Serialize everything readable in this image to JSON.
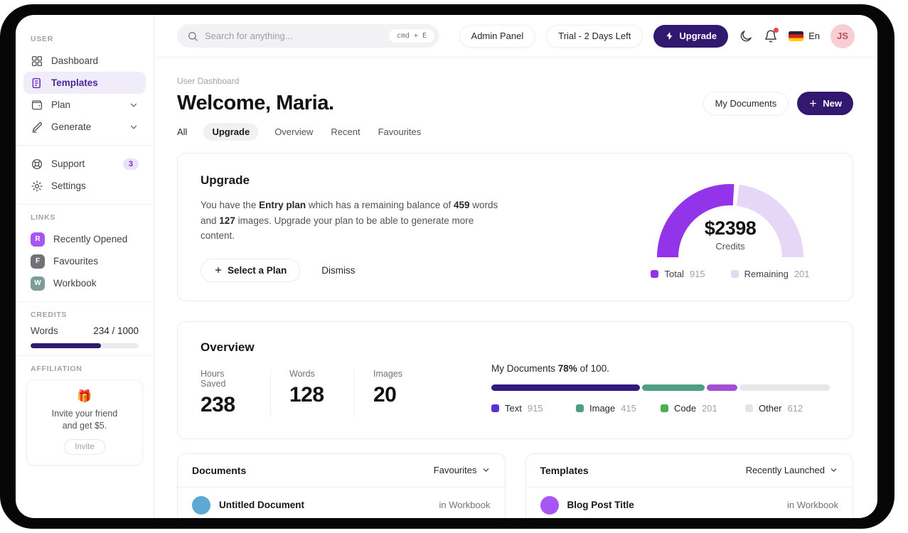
{
  "topbar": {
    "search_placeholder": "Search for anything...",
    "search_shortcut": "cmd + E",
    "admin_panel": "Admin Panel",
    "trial": "Trial - 2 Days Left",
    "upgrade": "Upgrade",
    "language": "En",
    "avatar_initials": "JS"
  },
  "sidebar": {
    "user_label": "USER",
    "nav": [
      {
        "label": "Dashboard"
      },
      {
        "label": "Templates"
      },
      {
        "label": "Plan"
      },
      {
        "label": "Generate"
      }
    ],
    "support": {
      "label": "Support",
      "badge": "3"
    },
    "settings": {
      "label": "Settings"
    },
    "links_label": "LINKS",
    "links": [
      {
        "initial": "R",
        "label": "Recently Opened",
        "color": "#a855f7"
      },
      {
        "initial": "F",
        "label": "Favourites",
        "color": "#71717a"
      },
      {
        "initial": "W",
        "label": "Workbook",
        "color": "#7d9e97"
      }
    ],
    "credits": {
      "label": "CREDITS",
      "metric": "Words",
      "value": "234 / 1000",
      "fill_pct": "65%",
      "fill_color": "#2f1a6e"
    },
    "affiliation": {
      "label": "AFFILIATION",
      "emoji": "🎁",
      "line1": "Invite your friend",
      "line2": "and get $5.",
      "button": "Invite"
    }
  },
  "page": {
    "breadcrumb": "User Dashboard",
    "title": "Welcome, Maria.",
    "my_documents": "My Documents",
    "new_button": "New",
    "tabs": [
      {
        "label": "All"
      },
      {
        "label": "Upgrade"
      },
      {
        "label": "Overview"
      },
      {
        "label": "Recent"
      },
      {
        "label": "Favourites"
      }
    ]
  },
  "upgrade_card": {
    "title": "Upgrade",
    "body": {
      "t1": "You have the ",
      "b1": "Entry plan",
      "t2": " which has a remaining balance of ",
      "b2": "459",
      "t3": " words and ",
      "b3": "127",
      "t4": " images. Upgrade your plan to be able to generate more content."
    },
    "select_plan": "Select a Plan",
    "dismiss": "Dismiss",
    "gauge": {
      "amount": "$2398",
      "caption": "Credits",
      "total_label": "Total",
      "total_value": "915",
      "total_color": "#9333ea",
      "remaining_label": "Remaining",
      "remaining_value": "201",
      "remaining_color": "#e6d7f6"
    }
  },
  "overview_card": {
    "title": "Overview",
    "stats": [
      {
        "label": "Hours Saved",
        "value": "238"
      },
      {
        "label": "Words",
        "value": "128"
      },
      {
        "label": "Images",
        "value": "20"
      }
    ],
    "docs_line": {
      "t1": "My Documents ",
      "pct": "78%",
      "t2": " of 100."
    },
    "bar_segments": [
      {
        "name": "Text",
        "width": "44%",
        "color": "#34187e"
      },
      {
        "name": "Image",
        "width": "18.5%",
        "color": "#4d9e82"
      },
      {
        "name": "Code",
        "width": "9%",
        "color": "#a24fd4"
      }
    ],
    "legend": [
      {
        "label": "Text",
        "value": "915",
        "color": "#5b30d5"
      },
      {
        "label": "Image",
        "value": "415",
        "color": "#4d9e82"
      },
      {
        "label": "Code",
        "value": "201",
        "color": "#4cae50"
      },
      {
        "label": "Other",
        "value": "612",
        "color": "#e4e4e7"
      }
    ]
  },
  "documents_card": {
    "title": "Documents",
    "filter": "Favourites",
    "row": {
      "title": "Untitled Document",
      "location": "in Workbook",
      "avatar_color": "#5fa8d3"
    }
  },
  "templates_card": {
    "title": "Templates",
    "filter": "Recently Launched",
    "row": {
      "title": "Blog Post Title",
      "location": "in Workbook",
      "avatar_color": "#a855f7"
    }
  },
  "chart_data": [
    {
      "type": "pie",
      "variant": "semicircle-donut",
      "center_label": "$2398",
      "center_caption": "Credits",
      "series": [
        {
          "name": "Total",
          "value": 915,
          "color": "#9333ea"
        },
        {
          "name": "Remaining",
          "value": 201,
          "color": "#e6d7f6"
        }
      ],
      "legend_position": "bottom"
    },
    {
      "type": "bar",
      "variant": "stacked-progress",
      "title": "My Documents 78% of 100.",
      "series": [
        {
          "name": "Text",
          "value": 915,
          "color": "#34187e"
        },
        {
          "name": "Image",
          "value": 415,
          "color": "#4d9e82"
        },
        {
          "name": "Code",
          "value": 201,
          "color": "#a24fd4"
        },
        {
          "name": "Other",
          "value": 612,
          "color": "#e4e4e7"
        }
      ]
    }
  ]
}
